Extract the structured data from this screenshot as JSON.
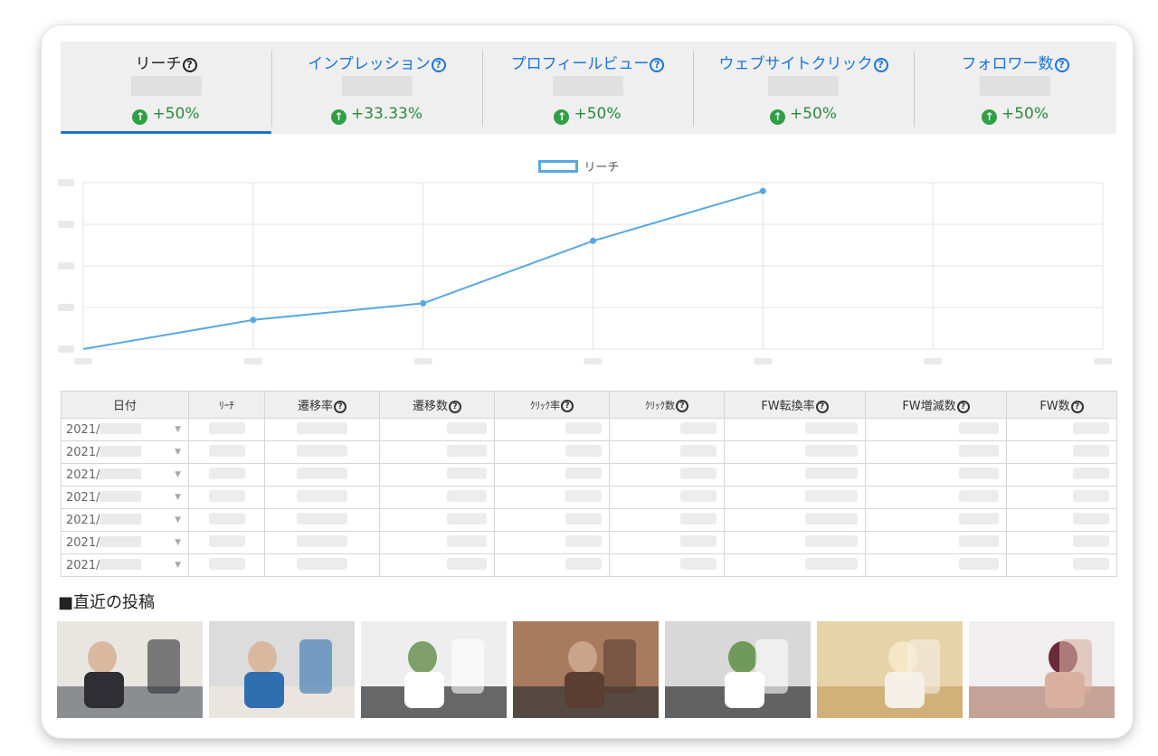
{
  "tabs": [
    {
      "label": "リーチ",
      "change": "+50%",
      "active": true
    },
    {
      "label": "インプレッション",
      "change": "+33.33%",
      "active": false
    },
    {
      "label": "プロフィールビュー",
      "change": "+50%",
      "active": false
    },
    {
      "label": "ウェブサイトクリック",
      "change": "+50%",
      "active": false
    },
    {
      "label": "フォロワー数",
      "change": "+50%",
      "active": false
    }
  ],
  "help_glyph": "?",
  "up_glyph": "↑",
  "chart_data": {
    "type": "line",
    "series": [
      {
        "name": "リーチ",
        "values": [
          0,
          0.7,
          1.1,
          2.6,
          3.8,
          null,
          null
        ]
      }
    ],
    "ylim": [
      0,
      4
    ],
    "grid": true,
    "legend": "top-center",
    "colors": {
      "line": "#58a8e0",
      "grid": "#e3e3e3"
    }
  },
  "table": {
    "headers": [
      "日付",
      "ﾘｰﾁ",
      "遷移率",
      "遷移数",
      "ｸﾘｯｸ率",
      "ｸﾘｯｸ数",
      "FW転換率",
      "FW増減数",
      "FW数"
    ],
    "header_help": [
      false,
      false,
      true,
      true,
      true,
      true,
      true,
      true,
      true
    ],
    "header_small": [
      false,
      true,
      false,
      false,
      true,
      true,
      false,
      false,
      false
    ],
    "rows": [
      {
        "date": "2021/"
      },
      {
        "date": "2021/"
      },
      {
        "date": "2021/"
      },
      {
        "date": "2021/"
      },
      {
        "date": "2021/"
      },
      {
        "date": "2021/"
      },
      {
        "date": "2021/"
      }
    ]
  },
  "recent_posts": {
    "title": "■直近の投稿",
    "count": 7
  }
}
